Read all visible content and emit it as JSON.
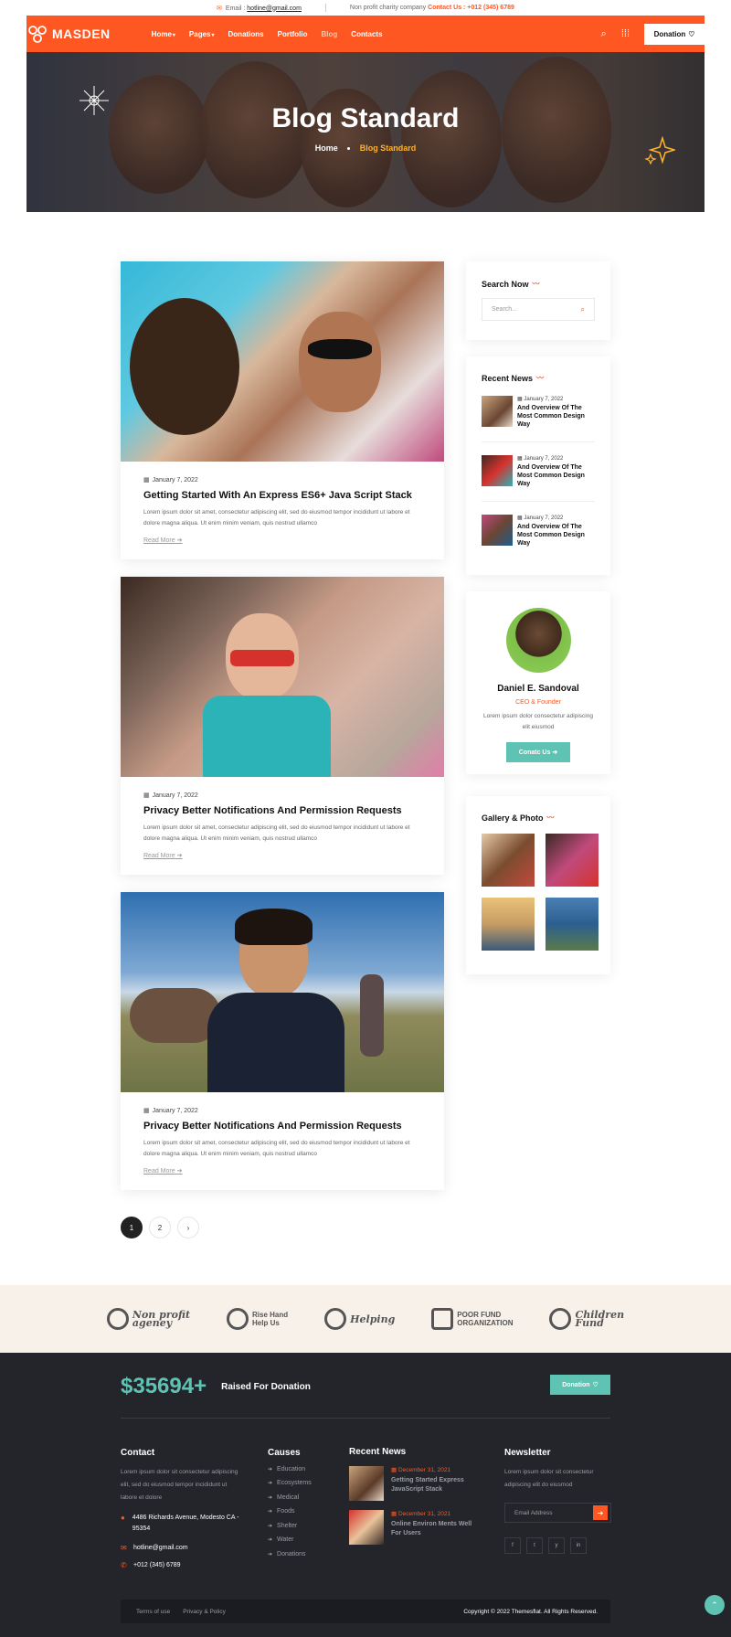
{
  "topbar": {
    "email_prefix": "Email :",
    "email": "hotline@gmail.com",
    "tagline": "Non profit charity company",
    "contact_label": "Contact Us : +012 (345) 6789"
  },
  "nav": {
    "logo": "MASDEN",
    "menu": [
      {
        "label": "Home",
        "caret": "▾"
      },
      {
        "label": "Pages",
        "caret": "▾"
      },
      {
        "label": "Donations",
        "caret": ""
      },
      {
        "label": "Portfolio",
        "caret": ""
      },
      {
        "label": "Blog",
        "caret": ""
      },
      {
        "label": "Contacts",
        "caret": ""
      }
    ],
    "donation_label": "Donation"
  },
  "hero": {
    "title": "Blog Standard",
    "crumb_home": "Home",
    "crumb_current": "Blog Standard"
  },
  "posts": [
    {
      "date": "January 7, 2022",
      "title": "Getting Started With An Express ES6+ Java Script Stack",
      "excerpt": "Lorem ipsum dolor sit amet, consectetur adipiscing elit, sed do eiusmod tempor incididunt ut labore et dolore magna aliqua. Ut enim minim veniam, quis nostrud ullamco",
      "more": "Read More"
    },
    {
      "date": "January 7, 2022",
      "title": "Privacy Better Notifications And Permission Requests",
      "excerpt": "Lorem ipsum dolor sit amet, consectetur adipiscing elit, sed do eiusmod tempor incididunt ut labore et dolore magna aliqua. Ut enim minim veniam, quis nostrud ullamco",
      "more": "Read More"
    },
    {
      "date": "January 7, 2022",
      "title": "Privacy Better Notifications And Permission Requests",
      "excerpt": "Lorem ipsum dolor sit amet, consectetur adipiscing elit, sed do eiusmod tempor incididunt ut labore et dolore magna aliqua. Ut enim minim veniam, quis nostrud ullamco",
      "more": "Read More"
    }
  ],
  "pagination": [
    "1",
    "2",
    "›"
  ],
  "sidebar": {
    "search_title": "Search Now",
    "search_placeholder": "Search...",
    "recent_title": "Recent News",
    "recent": [
      {
        "date": "January 7, 2022",
        "title": "And Overview Of The Most Common Design Way"
      },
      {
        "date": "January 7, 2022",
        "title": "And Overview Of The Most Common Design Way"
      },
      {
        "date": "January 7, 2022",
        "title": "And Overview Of The Most Common Design Way"
      }
    ],
    "profile": {
      "name": "Daniel E. Sandoval",
      "role": "CEO & Founder",
      "desc": "Lorem ipsum dolor consectetur adipiscing elit eiusmod",
      "button": "Conatc Us"
    },
    "gallery_title": "Gallery & Photo"
  },
  "partners": [
    {
      "line1": "Non profit",
      "line2": "ageney"
    },
    {
      "line1": "Rise Hand",
      "line2": "Help Us"
    },
    {
      "line1": "Helping",
      "line2": ""
    },
    {
      "line1": "POOR FUND",
      "line2": "ORGANIZATION"
    },
    {
      "line1": "Children",
      "line2": "Fund"
    }
  ],
  "footer": {
    "amount": "$35694+",
    "raised_label": "Raised For Donation",
    "donation_label": "Donation",
    "contact_title": "Contact",
    "contact_text": "Lorem ipsum dolor sit consectetur adipiscing elit, sed do eiusmod tempor incididunt ut labore et dolore",
    "address": "4486 Richards Avenue, Modesto CA - 95354",
    "email": "hotline@gmail.com",
    "phone": "+012 (345) 6789",
    "causes_title": "Causes",
    "causes": [
      "Education",
      "Ecosystems",
      "Medical",
      "Foods",
      "Shelter",
      "Water",
      "Donations"
    ],
    "news_title": "Recent News",
    "news": [
      {
        "date": "December 31, 2021",
        "title": "Getting Started Express JavaScript Stack"
      },
      {
        "date": "December 31, 2021",
        "title": "Online Environ Ments Well For Users"
      }
    ],
    "newsletter_title": "Newsletter",
    "newsletter_text": "Lorem ipsum dolor sit consectetur adipiscing elit do eiusmod",
    "email_placeholder": "Email Address",
    "social": [
      "f",
      "t",
      "y",
      "in"
    ],
    "terms": "Terms of use",
    "privacy": "Privacy & Policy",
    "copyright": "Copyright © 2022 Themesflat. All Rights Reserved."
  },
  "colors": {
    "accent": "#ff5722",
    "teal": "#5fc3b3",
    "dark": "#23252b"
  }
}
